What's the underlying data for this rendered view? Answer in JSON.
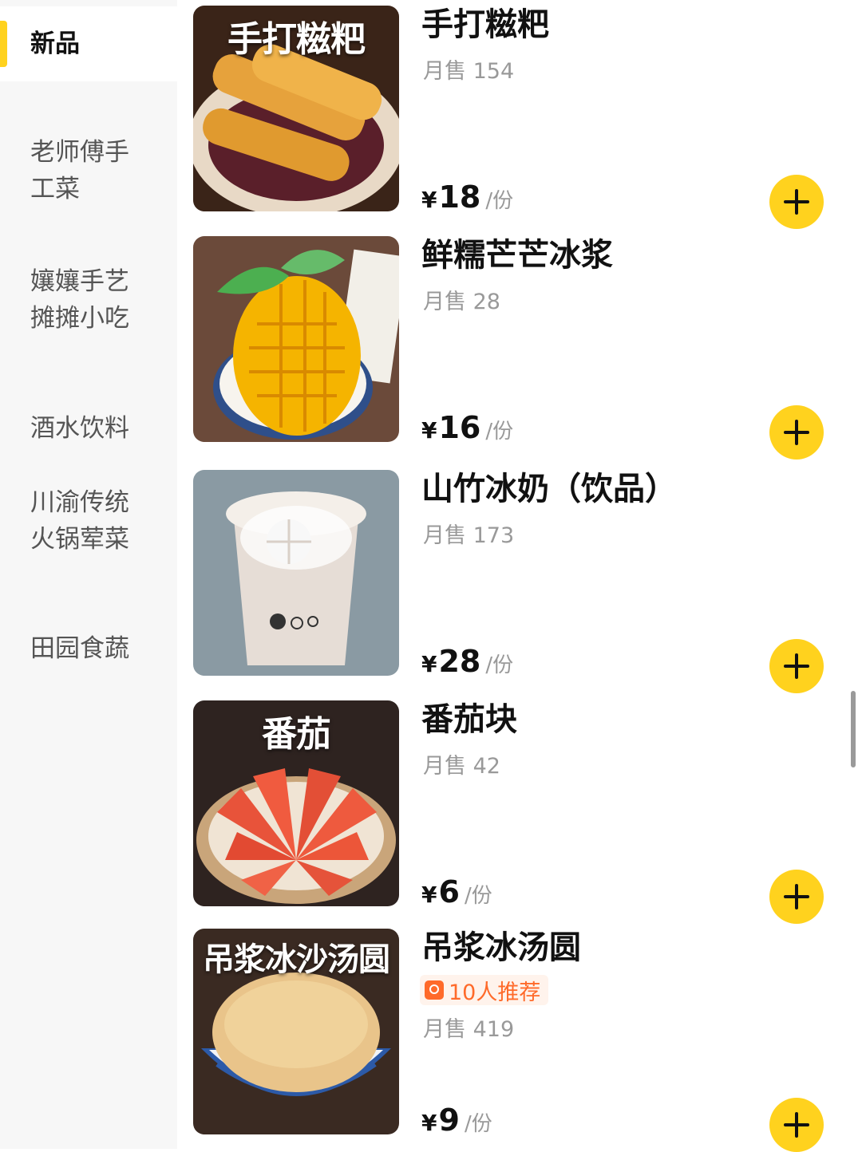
{
  "categories": [
    {
      "label": "新品"
    },
    {
      "label": "老师傅手工菜"
    },
    {
      "label": "孃孃手艺摊摊小吃"
    },
    {
      "label": "酒水饮料"
    },
    {
      "label": "川渝传统火锅荤菜"
    },
    {
      "label": "田园食蔬"
    }
  ],
  "products": [
    {
      "name": "手打糍粑",
      "image_text": "手打糍粑",
      "sales": "月售 154",
      "currency": "¥",
      "price": "18",
      "unit": "/份"
    },
    {
      "name": "鲜糯芒芒冰浆",
      "image_text": "",
      "sales": "月售 28",
      "currency": "¥",
      "price": "16",
      "unit": "/份"
    },
    {
      "name": "山竹冰奶（饮品）",
      "image_text": "",
      "sales": "月售 173",
      "currency": "¥",
      "price": "28",
      "unit": "/份"
    },
    {
      "name": "番茄块",
      "image_text": "番茄",
      "sales": "月售 42",
      "currency": "¥",
      "price": "6",
      "unit": "/份"
    },
    {
      "name": "吊浆冰汤圆",
      "image_text": "吊浆冰沙汤圆",
      "recommend": "10人推荐",
      "sales": "月售 419",
      "currency": "¥",
      "price": "9",
      "unit": "/份"
    }
  ],
  "colors": {
    "accent": "#ffd21e",
    "recommend": "#ff6a2a"
  },
  "icons": {
    "add": "plus-icon",
    "recommend": "thumb-badge-icon"
  }
}
